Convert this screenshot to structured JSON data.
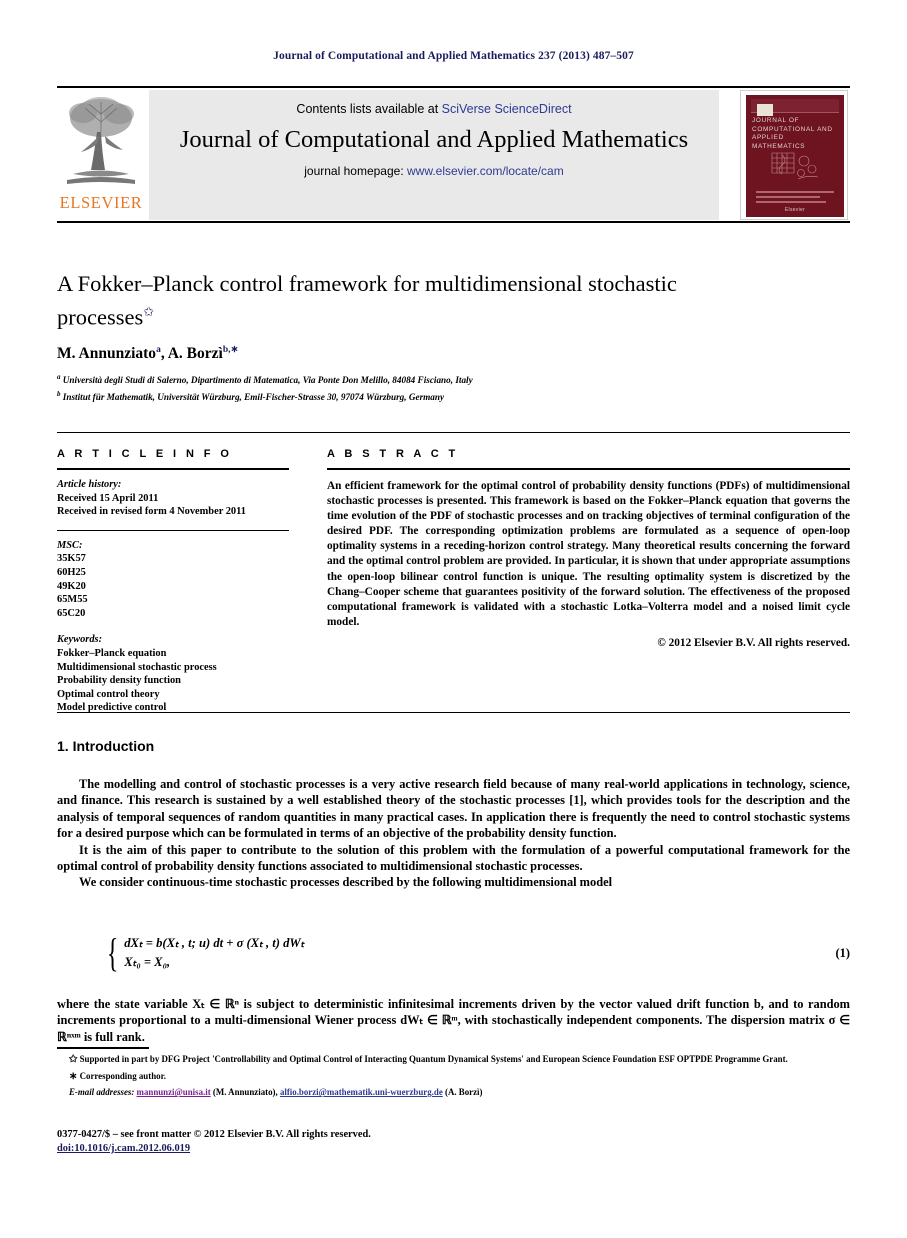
{
  "running_head": "Journal of Computational and Applied Mathematics 237 (2013) 487–507",
  "masthead": {
    "contents_prefix": "Contents lists available at ",
    "contents_link": "SciVerse ScienceDirect",
    "journal_title": "Journal of Computational and Applied Mathematics",
    "homepage_prefix": "journal homepage: ",
    "homepage_url": "www.elsevier.com/locate/cam",
    "publisher_wordmark": "ELSEVIER",
    "publisher_logo_icon": "elsevier-tree-icon",
    "cover": {
      "title": "JOURNAL OF COMPUTATIONAL AND APPLIED MATHEMATICS",
      "footer": "Elsevier",
      "figure_icon": "grid-graph-icon",
      "color": "#6e1420"
    },
    "accent_link_color": "#2e3a93",
    "brand_color": "#e87722"
  },
  "article": {
    "title": "A Fokker–Planck control framework for multidimensional stochastic processes",
    "title_footnote_marker": "✩",
    "authors": "M. Annunziato",
    "author_1": "M. Annunziato",
    "author_1_sup": "a",
    "author_2": "A. Borzì",
    "author_2_sup": "b,",
    "author_2_corr": "∗",
    "affiliations": [
      {
        "marker": "a",
        "text": "Università degli Studi di Salerno, Dipartimento di Matematica, Via Ponte Don Melillo, 84084 Fisciano, Italy"
      },
      {
        "marker": "b",
        "text": "Institut für Mathematik, Universität Würzburg, Emil-Fischer-Strasse 30, 97074 Würzburg, Germany"
      }
    ]
  },
  "info": {
    "heading": "A R T I C L E   I N F O",
    "history_label": "Article history:",
    "history": [
      "Received 15 April 2011",
      "Received in revised form 4 November 2011"
    ],
    "msc_label": "MSC:",
    "msc": [
      "35K57",
      "60H25",
      "49K20",
      "65M55",
      "65C20"
    ],
    "keywords_label": "Keywords:",
    "keywords": [
      "Fokker–Planck equation",
      "Multidimensional stochastic process",
      "Probability density function",
      "Optimal control theory",
      "Model predictive control"
    ]
  },
  "abstract": {
    "heading": "A B S T R A C T",
    "text": "An efficient framework for the optimal control of probability density functions (PDFs) of multidimensional stochastic processes is presented. This framework is based on the Fokker–Planck equation that governs the time evolution of the PDF of stochastic processes and on tracking objectives of terminal configuration of the desired PDF. The corresponding optimization problems are formulated as a sequence of open-loop optimality systems in a receding-horizon control strategy. Many theoretical results concerning the forward and the optimal control problem are provided. In particular, it is shown that under appropriate assumptions the open-loop bilinear control function is unique. The resulting optimality system is discretized by the Chang–Cooper scheme that guarantees positivity of the forward solution. The effectiveness of the proposed computational framework is validated with a stochastic Lotka–Volterra model and a noised limit cycle model.",
    "copyright": "© 2012 Elsevier B.V. All rights reserved."
  },
  "body": {
    "section_heading": "1. Introduction",
    "paragraph_1": "The modelling and control of stochastic processes is a very active research field because of many real-world applications in technology, science, and finance. This research is sustained by a well established theory of the stochastic processes [1], which provides tools for the description and the analysis of temporal sequences of random quantities in many practical cases. In application there is frequently the need to control stochastic systems for a desired purpose which can be formulated in terms of an objective of the probability density function.",
    "paragraph_2": "It is the aim of this paper to contribute to the solution of this problem with the formulation of a powerful computational framework for the optimal control of probability density functions associated to multidimensional stochastic processes.",
    "paragraph_3": "We consider continuous-time stochastic processes described by the following multidimensional model",
    "equation": {
      "line_1": "dXₜ = b(Xₜ , t; u) dt + σ (Xₜ , t) dWₜ",
      "line_2": "Xₜ₀ = X₀,",
      "number": "(1)"
    },
    "paragraph_4": "where the state variable Xₜ ∈ ℝⁿ is subject to deterministic infinitesimal increments driven by the vector valued drift function b, and to random increments proportional to a multi-dimensional Wiener process dWₜ ∈ ℝᵐ, with stochastically independent components. The dispersion matrix σ ∈ ℝⁿˣᵐ is full rank."
  },
  "footnotes": {
    "grant_marker": "✩",
    "grant": "Supported in part by DFG Project 'Controllability and Optimal Control of Interacting Quantum Dynamical Systems' and European Science Foundation ESF OPTPDE Programme Grant.",
    "corresponding_marker": "∗",
    "corresponding": "Corresponding author.",
    "email_label": "E-mail addresses:",
    "emails": [
      {
        "address": "mannunzi@unisa.it",
        "who": "(M. Annunziato)"
      },
      {
        "address": "alfio.borzi@mathematik.uni-wuerzburg.de",
        "who": "(A. Borzì)"
      }
    ]
  },
  "imprint": {
    "front_matter": "0377-0427/$ – see front matter © 2012 Elsevier B.V. All rights reserved.",
    "doi": "doi:10.1016/j.cam.2012.06.019"
  }
}
